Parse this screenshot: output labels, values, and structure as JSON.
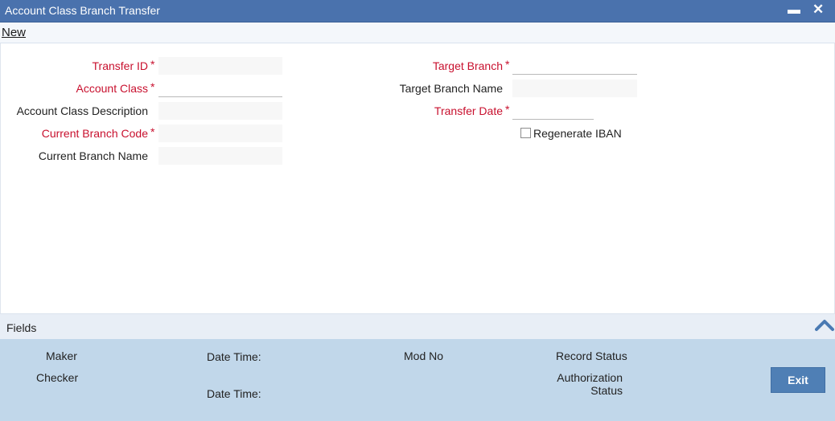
{
  "window": {
    "title": "Account Class Branch Transfer",
    "minimize_glyph": "▬",
    "close_glyph": "✕"
  },
  "toolbar": {
    "new_label": "New"
  },
  "form": {
    "transfer_id": {
      "label": "Transfer ID",
      "required": "*",
      "value": ""
    },
    "account_class": {
      "label": "Account Class",
      "required": "*",
      "value": ""
    },
    "account_class_description": {
      "label": "Account Class Description",
      "value": ""
    },
    "current_branch_code": {
      "label": "Current Branch Code",
      "required": "*",
      "value": ""
    },
    "current_branch_name": {
      "label": "Current Branch Name",
      "value": ""
    },
    "target_branch": {
      "label": "Target Branch",
      "required": "*",
      "value": ""
    },
    "target_branch_name": {
      "label": "Target Branch Name",
      "value": ""
    },
    "transfer_date": {
      "label": "Transfer Date",
      "required": "*",
      "value": ""
    },
    "regenerate_iban": {
      "label": "Regenerate IBAN",
      "checked": false
    }
  },
  "fields_bar": {
    "label": "Fields",
    "icon": "chevron-up-icon"
  },
  "audit": {
    "maker": "Maker",
    "checker": "Checker",
    "date_time_1": "Date Time:",
    "date_time_2": "Date Time:",
    "mod_no": "Mod No",
    "record_status": "Record Status",
    "authorization_line1": "Authorization",
    "authorization_line2": "Status",
    "exit_label": "Exit"
  },
  "colors": {
    "titlebar": "#4a72ad",
    "required_label": "#c8102e",
    "audit_panel": "#c1d7ea",
    "exit_button": "#4f7fb5"
  }
}
